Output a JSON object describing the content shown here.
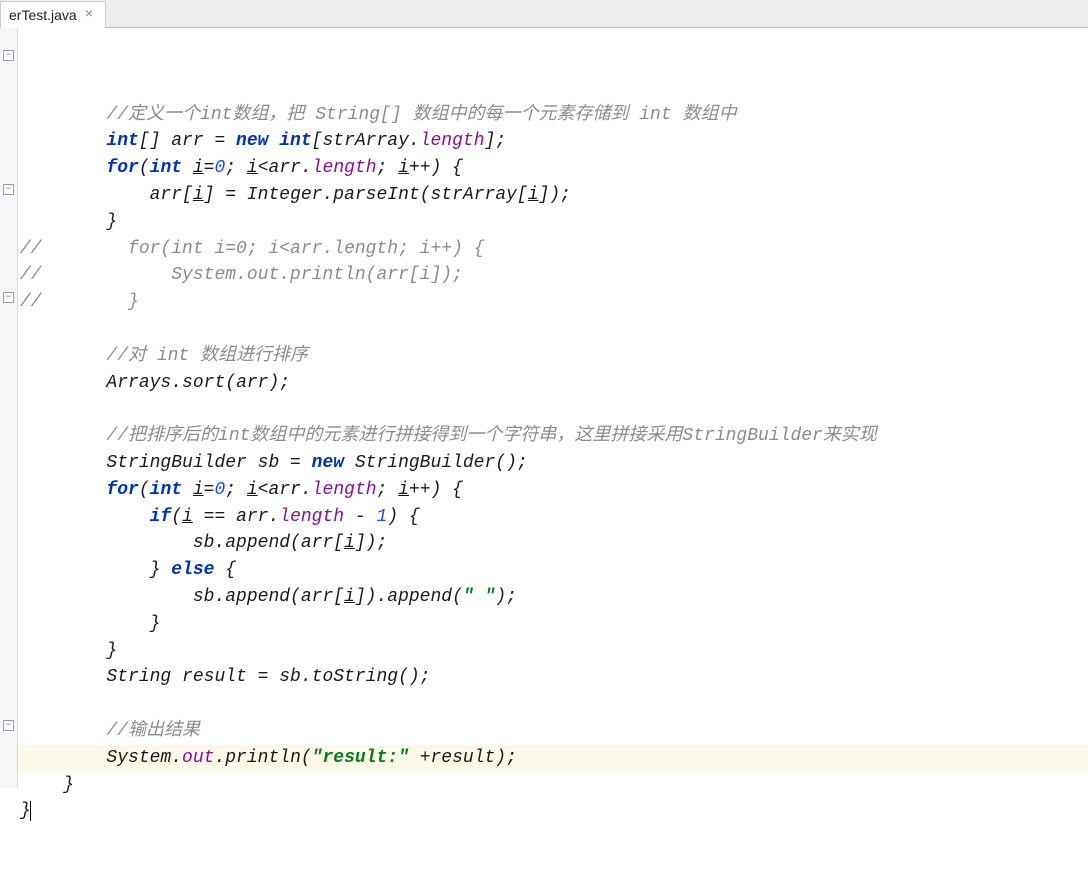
{
  "tab": {
    "label": "erTest.java"
  },
  "code": {
    "c1": "//定义一个int数组，把 String[] 数组中的每一个元素存储到 int 数组中",
    "l2": {
      "kw1": "int",
      "t1": "[] arr = ",
      "kw2": "new int",
      "t2": "[strArray.",
      "fld1": "length",
      "t3": "];"
    },
    "l3": {
      "kw1": "for",
      "t1": "(",
      "kw2": "int ",
      "v": "i",
      "t2": "=",
      "n": "0",
      "t3": "; ",
      "v2": "i",
      "t4": "<arr.",
      "fld1": "length",
      "t5": "; ",
      "v3": "i",
      "t6": "++) {"
    },
    "l4": {
      "t1": "arr[",
      "v": "i",
      "t2": "] = Integer.",
      "m": "parseInt",
      "t3": "(strArray[",
      "v2": "i",
      "t4": "]);"
    },
    "l5": "}",
    "c6a": "//",
    "c6b": "for(int i=0; i<arr.length; i++) {",
    "c7a": "//",
    "c7b": "System.out.println(arr[i]);",
    "c8a": "//",
    "c8b": "}",
    "c10": "//对 int 数组进行排序",
    "l11": {
      "t1": "Arrays.",
      "m": "sort",
      "t2": "(arr);"
    },
    "c13": "//把排序后的int数组中的元素进行拼接得到一个字符串，这里拼接采用StringBuilder来实现",
    "l14": {
      "t1": "StringBuilder sb = ",
      "kw": "new",
      "t2": " StringBuilder();"
    },
    "l15": {
      "kw1": "for",
      "t1": "(",
      "kw2": "int ",
      "v": "i",
      "t2": "=",
      "n": "0",
      "t3": "; ",
      "v2": "i",
      "t4": "<arr.",
      "fld1": "length",
      "t5": "; ",
      "v3": "i",
      "t6": "++) {"
    },
    "l16": {
      "kw": "if",
      "t1": "(",
      "v": "i",
      "t2": " == arr.",
      "fld": "length",
      "t3": " - ",
      "n": "1",
      "t4": ") {"
    },
    "l17": {
      "t1": "sb.append(arr[",
      "v": "i",
      "t2": "]);"
    },
    "l18": {
      "t1": "} ",
      "kw": "else",
      "t2": " {"
    },
    "l19": {
      "t1": "sb.append(arr[",
      "v": "i",
      "t2": "]).append(",
      "s": "\" \"",
      "t3": ");"
    },
    "l20": "}",
    "l21": "}",
    "l22": "String result = sb.toString();",
    "c24": "//输出结果",
    "l25": {
      "t1": "System.",
      "fld": "out",
      "t2": ".println(",
      "s": "\"result:\"",
      "t3": " +result);"
    },
    "l26": "}",
    "l27": "}"
  }
}
